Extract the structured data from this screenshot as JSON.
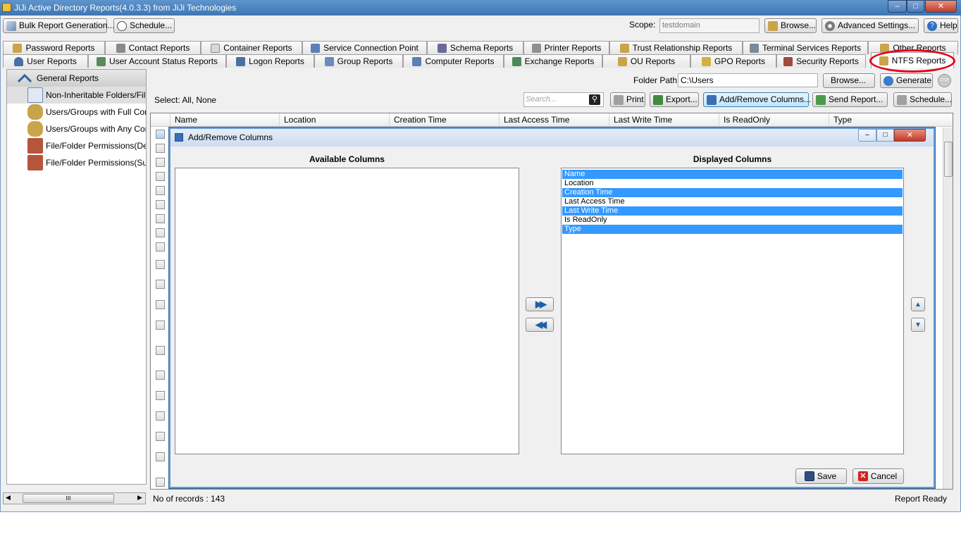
{
  "window": {
    "title": "JiJi Active Directory Reports(4.0.3.3) from JiJi Technologies",
    "min": "–",
    "max": "□",
    "close": "✕"
  },
  "toolbar": {
    "bulk_label": "Bulk Report Generation...",
    "schedule_label": "Schedule...",
    "scope_label": "Scope:",
    "scope_value": "testdomain",
    "browse_label": "Browse...",
    "advanced_label": "Advanced  Settings...",
    "help_label": "Help"
  },
  "tabs_row1": [
    {
      "label": "Password Reports"
    },
    {
      "label": "Contact Reports"
    },
    {
      "label": "Container Reports"
    },
    {
      "label": "Service Connection Point"
    },
    {
      "label": "Schema Reports"
    },
    {
      "label": "Printer Reports"
    },
    {
      "label": "Trust Relationship Reports"
    },
    {
      "label": "Terminal Services Reports"
    },
    {
      "label": "Other Reports"
    }
  ],
  "tabs_row2": [
    {
      "label": "User Reports"
    },
    {
      "label": "User Account Status Reports"
    },
    {
      "label": "Logon Reports"
    },
    {
      "label": "Group Reports"
    },
    {
      "label": "Computer Reports"
    },
    {
      "label": "Exchange Reports"
    },
    {
      "label": "OU Reports"
    },
    {
      "label": "GPO Reports"
    },
    {
      "label": "Security Reports"
    },
    {
      "label": "NTFS Reports"
    }
  ],
  "sidebar": {
    "header": "General Reports",
    "items": [
      {
        "label": "Non-Inheritable Folders/Files"
      },
      {
        "label": "Users/Groups with Full Control"
      },
      {
        "label": "Users/Groups with Any Control"
      },
      {
        "label": "File/Folder Permissions(Detailed)"
      },
      {
        "label": "File/Folder Permissions(Summary)"
      }
    ],
    "scroll_thumb": "III"
  },
  "content": {
    "folder_path_label": "Folder Path:",
    "folder_path_value": "C:\\Users",
    "browse_label": "Browse...",
    "generate_label": "Generate",
    "stop_label": "STOP",
    "select_text": "Select:  All,  None",
    "search_placeholder": "Search...",
    "print_label": "Print",
    "export_label": "Export...",
    "add_remove_label": "Add/Remove Columns...",
    "send_report_label": "Send Report...",
    "schedule_label": "Schedule..."
  },
  "grid": {
    "columns": [
      "Name",
      "Location",
      "Creation Time",
      "Last Access Time",
      "Last Write Time",
      "Is ReadOnly",
      "Type"
    ]
  },
  "dialog": {
    "title": "Add/Remove Columns",
    "available_label": "Available Columns",
    "displayed_label": "Displayed Columns",
    "displayed": [
      {
        "label": "Name",
        "selected": true
      },
      {
        "label": "Location",
        "selected": false
      },
      {
        "label": "Creation Time",
        "selected": true
      },
      {
        "label": "Last Access Time",
        "selected": false
      },
      {
        "label": "Last Write Time",
        "selected": true
      },
      {
        "label": "Is ReadOnly",
        "selected": false
      },
      {
        "label": "Type",
        "selected": true
      }
    ],
    "add_arrow": "▶▶",
    "remove_arrow": "◀◀",
    "up_arrow": "▲",
    "down_arrow": "▼",
    "save_label": "Save",
    "cancel_label": "Cancel"
  },
  "status": {
    "records": "No of records : 143",
    "state": "Report Ready"
  },
  "colors": {
    "selection": "#3399ff",
    "highlight_ring": "#e0001b",
    "titlebar": "#4a80bf"
  }
}
